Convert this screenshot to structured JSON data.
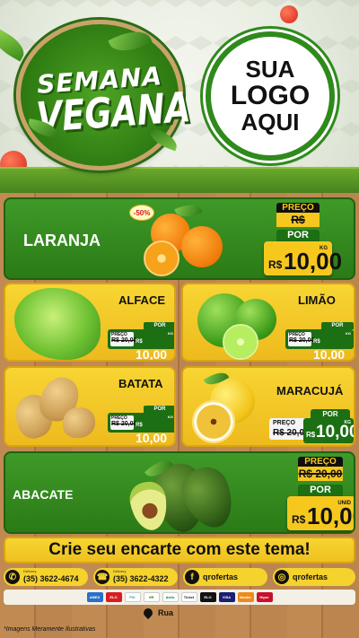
{
  "header": {
    "badge_line1": "SEMANA",
    "badge_line2": "VEGANA",
    "logo_line1": "SUA",
    "logo_line2": "LOGO",
    "logo_line3": "AQUI"
  },
  "products": {
    "laranja": {
      "name": "LARANJA",
      "discount": "-50%",
      "price_label": "PREÇO",
      "old_price": "R$ 20,00",
      "por_label": "POR",
      "currency": "R$",
      "new_price": "10,00",
      "unit": "KG"
    },
    "alface": {
      "name": "ALFACE",
      "price_label": "PREÇO",
      "old_price": "R$ 20,00",
      "por_label": "POR",
      "currency": "R$",
      "new_price": "10,00",
      "unit": "KG"
    },
    "limao": {
      "name": "LIMÃO",
      "price_label": "PREÇO",
      "old_price": "R$ 20,00",
      "por_label": "POR",
      "currency": "R$",
      "new_price": "10,00",
      "unit": "KG"
    },
    "batata": {
      "name": "BATATA",
      "price_label": "PREÇO",
      "old_price": "R$ 20,00",
      "por_label": "POR",
      "currency": "R$",
      "new_price": "10,00",
      "unit": "KG"
    },
    "maracuja": {
      "name": "MARACUJÁ",
      "price_label": "PREÇO",
      "old_price": "R$ 20,00",
      "por_label": "POR",
      "currency": "R$",
      "new_price": "10,00",
      "unit": "KG"
    },
    "abacate": {
      "name": "ABACATE",
      "price_label": "PREÇO",
      "old_price": "R$ 20,00",
      "por_label": "POR",
      "currency": "R$",
      "new_price": "10,00",
      "unit": "UNID"
    }
  },
  "cta": "Crie seu encarte com este tema!",
  "contacts": {
    "whatsapp_small": "Delivery",
    "whatsapp": "(35) 3622-4674",
    "phone_small": "Delivery",
    "phone": "(35) 3622-4322",
    "facebook": "qrofertas",
    "instagram": "qrofertas"
  },
  "payments": [
    "AMEX",
    "ELO",
    "PIX",
    "VR",
    "Alelo",
    "Ticket",
    "ELO",
    "VISA",
    "Master",
    "Hiper"
  ],
  "address": "Rua",
  "disclaimer": "*Imagens Meramente Ilustrativas",
  "colors": {
    "green": "#2f8a1c",
    "yellow": "#f6c81e",
    "dark": "#0f0f0f"
  }
}
